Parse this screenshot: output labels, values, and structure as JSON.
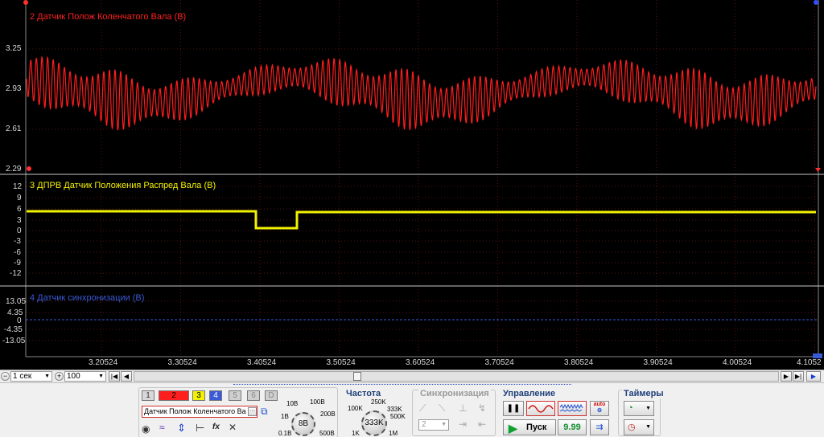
{
  "channels": [
    {
      "title": "2 Датчик Полож Коленчатого Вала (В)",
      "color": "#ff2020",
      "y_ticks": [
        "3.25",
        "2.93",
        "2.61",
        "2.29"
      ]
    },
    {
      "title": "3 ДПРВ Датчик Положения Распред Вала (В)",
      "color": "#f2f200",
      "y_ticks": [
        "12",
        "9",
        "6",
        "3",
        "0",
        "-3",
        "-6",
        "-9",
        "-12"
      ]
    },
    {
      "title": "4 Датчик синхронизации (В)",
      "color": "#3a5ad8",
      "y_ticks": [
        "13.05",
        "4.35",
        "0",
        "-4.35",
        "-13.05"
      ]
    }
  ],
  "x_ticks": [
    "3.20524",
    "3.30524",
    "3.40524",
    "3.50524",
    "3.60524",
    "3.70524",
    "3.80524",
    "3.90524",
    "4.00524",
    "4.1052"
  ],
  "timebar": {
    "timebase": "1 сек",
    "zoom": "100"
  },
  "panel": {
    "channel_tabs": [
      "1",
      "2",
      "3",
      "4",
      "5",
      "6",
      "D"
    ],
    "channel_select": "Датчик Полож Коленчатого Ва",
    "voltage": {
      "value": "8В",
      "labels": [
        "10В",
        "100В",
        "1В",
        "200В",
        "0.1В",
        "500В"
      ]
    },
    "frequency": {
      "title": "Частота",
      "value": "333K",
      "labels": [
        "250K",
        "100K",
        "333K",
        "500K",
        "1K",
        "1M"
      ]
    },
    "sync": {
      "title": "Синхронизация",
      "value": "2"
    },
    "control": {
      "title": "Управление",
      "start": "Пуск",
      "value": "9.99",
      "auto": "auto"
    },
    "timers": {
      "title": "Таймеры"
    }
  }
}
